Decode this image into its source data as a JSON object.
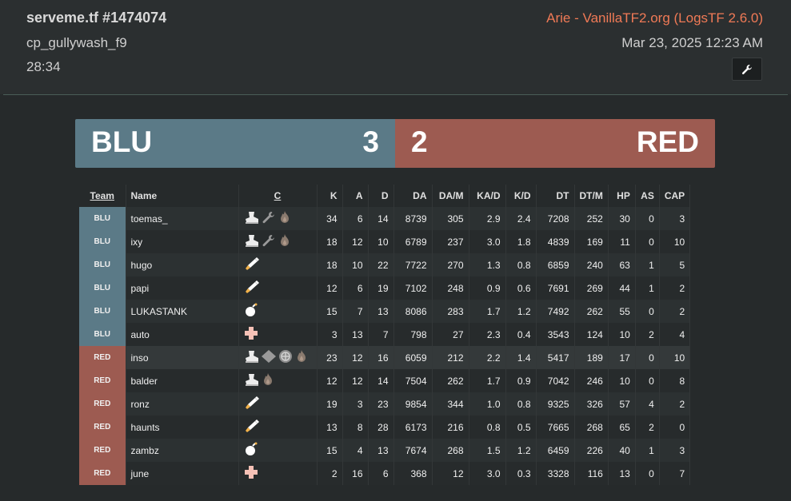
{
  "header": {
    "title": "serveme.tf #1474074",
    "map": "cp_gullywash_f9",
    "duration": "28:34",
    "uploader": "Arie - VanillaTF2.org (LogsTF 2.6.0)",
    "date": "Mar 23, 2025 12:23 AM",
    "tool_icon": "wrench-icon"
  },
  "score": {
    "blu_label": "BLU",
    "blu_score": "3",
    "red_label": "RED",
    "red_score": "2"
  },
  "colors": {
    "blu": "#5b7a87",
    "red": "#9d5b51",
    "accent": "#f07a56"
  },
  "table": {
    "columns": [
      "Team",
      "Name",
      "C",
      "K",
      "A",
      "D",
      "DA",
      "DA/M",
      "KA/D",
      "K/D",
      "DT",
      "DT/M",
      "HP",
      "AS",
      "CAP"
    ],
    "rows": [
      {
        "team": "BLU",
        "name": "toemas_",
        "classes": [
          "scout",
          "engineer",
          "pyro"
        ],
        "k": "34",
        "a": "6",
        "d": "14",
        "da": "8739",
        "dam": "305",
        "kad": "2.9",
        "kd": "2.4",
        "dt": "7208",
        "dtm": "252",
        "hp": "30",
        "as": "0",
        "cap": "3"
      },
      {
        "team": "BLU",
        "name": "ixy",
        "classes": [
          "scout",
          "engineer",
          "pyro"
        ],
        "k": "18",
        "a": "12",
        "d": "10",
        "da": "6789",
        "dam": "237",
        "kad": "3.0",
        "kd": "1.8",
        "dt": "4839",
        "dtm": "169",
        "hp": "11",
        "as": "0",
        "cap": "10"
      },
      {
        "team": "BLU",
        "name": "hugo",
        "classes": [
          "soldier"
        ],
        "k": "18",
        "a": "10",
        "d": "22",
        "da": "7722",
        "dam": "270",
        "kad": "1.3",
        "kd": "0.8",
        "dt": "6859",
        "dtm": "240",
        "hp": "63",
        "as": "1",
        "cap": "5"
      },
      {
        "team": "BLU",
        "name": "papi",
        "classes": [
          "soldier"
        ],
        "k": "12",
        "a": "6",
        "d": "19",
        "da": "7102",
        "dam": "248",
        "kad": "0.9",
        "kd": "0.6",
        "dt": "7691",
        "dtm": "269",
        "hp": "44",
        "as": "1",
        "cap": "2"
      },
      {
        "team": "BLU",
        "name": "LUKASTANK",
        "classes": [
          "demoman"
        ],
        "k": "15",
        "a": "7",
        "d": "13",
        "da": "8086",
        "dam": "283",
        "kad": "1.7",
        "kd": "1.2",
        "dt": "7492",
        "dtm": "262",
        "hp": "55",
        "as": "0",
        "cap": "2"
      },
      {
        "team": "BLU",
        "name": "auto",
        "classes": [
          "medic"
        ],
        "k": "3",
        "a": "13",
        "d": "7",
        "da": "798",
        "dam": "27",
        "kad": "2.3",
        "kd": "0.4",
        "dt": "3543",
        "dtm": "124",
        "hp": "10",
        "as": "2",
        "cap": "4"
      },
      {
        "team": "RED",
        "name": "inso",
        "classes": [
          "scout",
          "spy",
          "heavy",
          "pyro"
        ],
        "k": "23",
        "a": "12",
        "d": "16",
        "da": "6059",
        "dam": "212",
        "kad": "2.2",
        "kd": "1.4",
        "dt": "5417",
        "dtm": "189",
        "hp": "17",
        "as": "0",
        "cap": "10"
      },
      {
        "team": "RED",
        "name": "balder",
        "classes": [
          "scout",
          "pyro"
        ],
        "k": "12",
        "a": "12",
        "d": "14",
        "da": "7504",
        "dam": "262",
        "kad": "1.7",
        "kd": "0.9",
        "dt": "7042",
        "dtm": "246",
        "hp": "10",
        "as": "0",
        "cap": "8"
      },
      {
        "team": "RED",
        "name": "ronz",
        "classes": [
          "soldier"
        ],
        "k": "19",
        "a": "3",
        "d": "23",
        "da": "9854",
        "dam": "344",
        "kad": "1.0",
        "kd": "0.8",
        "dt": "9325",
        "dtm": "326",
        "hp": "57",
        "as": "4",
        "cap": "2"
      },
      {
        "team": "RED",
        "name": "haunts",
        "classes": [
          "soldier"
        ],
        "k": "13",
        "a": "8",
        "d": "28",
        "da": "6173",
        "dam": "216",
        "kad": "0.8",
        "kd": "0.5",
        "dt": "7665",
        "dtm": "268",
        "hp": "65",
        "as": "2",
        "cap": "0"
      },
      {
        "team": "RED",
        "name": "zambz",
        "classes": [
          "demoman"
        ],
        "k": "15",
        "a": "4",
        "d": "13",
        "da": "7674",
        "dam": "268",
        "kad": "1.5",
        "kd": "1.2",
        "dt": "6459",
        "dtm": "226",
        "hp": "40",
        "as": "1",
        "cap": "3"
      },
      {
        "team": "RED",
        "name": "june",
        "classes": [
          "medic"
        ],
        "k": "2",
        "a": "16",
        "d": "6",
        "da": "368",
        "dam": "12",
        "kad": "3.0",
        "kd": "0.3",
        "dt": "3328",
        "dtm": "116",
        "hp": "13",
        "as": "0",
        "cap": "7"
      }
    ]
  }
}
